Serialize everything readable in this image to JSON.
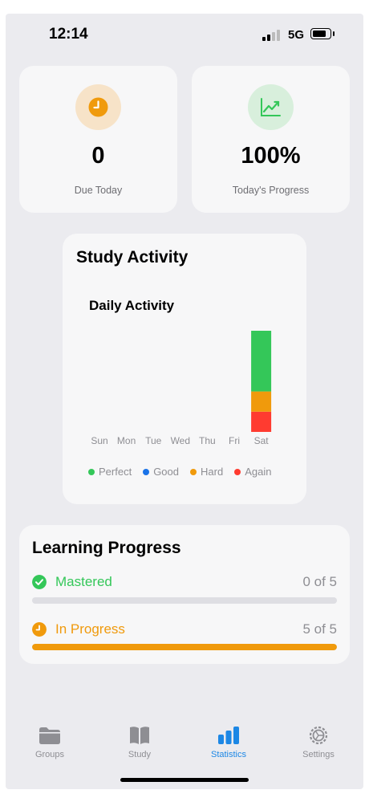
{
  "status_bar": {
    "time": "12:14",
    "network": "5G"
  },
  "stats": [
    {
      "value": "0",
      "label": "Due Today",
      "icon": "clock-icon",
      "color": "#f09a0c",
      "bg": "#f7e3c8"
    },
    {
      "value": "100%",
      "label": "Today's Progress",
      "icon": "trend-up-icon",
      "color": "#34c759",
      "bg": "#d8efdc"
    }
  ],
  "study_activity": {
    "title": "Study Activity",
    "chart_data": {
      "type": "bar",
      "stacked": true,
      "title": "Daily Activity",
      "categories": [
        "Sun",
        "Mon",
        "Tue",
        "Wed",
        "Thu",
        "Fri",
        "Sat"
      ],
      "series": [
        {
          "name": "Perfect",
          "color": "#34c759",
          "values": [
            0,
            0,
            0,
            0,
            0,
            0,
            3
          ]
        },
        {
          "name": "Good",
          "color": "#1a73e8",
          "values": [
            0,
            0,
            0,
            0,
            0,
            0,
            0
          ]
        },
        {
          "name": "Hard",
          "color": "#f09a0c",
          "values": [
            0,
            0,
            0,
            0,
            0,
            0,
            1
          ]
        },
        {
          "name": "Again",
          "color": "#ff3b30",
          "values": [
            0,
            0,
            0,
            0,
            0,
            0,
            1
          ]
        }
      ],
      "legend_position": "bottom",
      "grid": false
    }
  },
  "learning_progress": {
    "title": "Learning Progress",
    "items": [
      {
        "name": "Mastered",
        "count": "0 of 5",
        "fraction": 0,
        "color": "#34c759",
        "icon": "checkmark-circle-icon"
      },
      {
        "name": "In Progress",
        "count": "5 of 5",
        "fraction": 1,
        "color": "#f09a0c",
        "icon": "clock-icon"
      }
    ]
  },
  "tabs": [
    {
      "label": "Groups",
      "icon": "folder-icon",
      "active": false
    },
    {
      "label": "Study",
      "icon": "book-icon",
      "active": false
    },
    {
      "label": "Statistics",
      "icon": "bar-chart-icon",
      "active": true
    },
    {
      "label": "Settings",
      "icon": "gear-icon",
      "active": false
    }
  ],
  "colors": {
    "accent": "#1c87e5",
    "inactive": "#8e8e93"
  }
}
